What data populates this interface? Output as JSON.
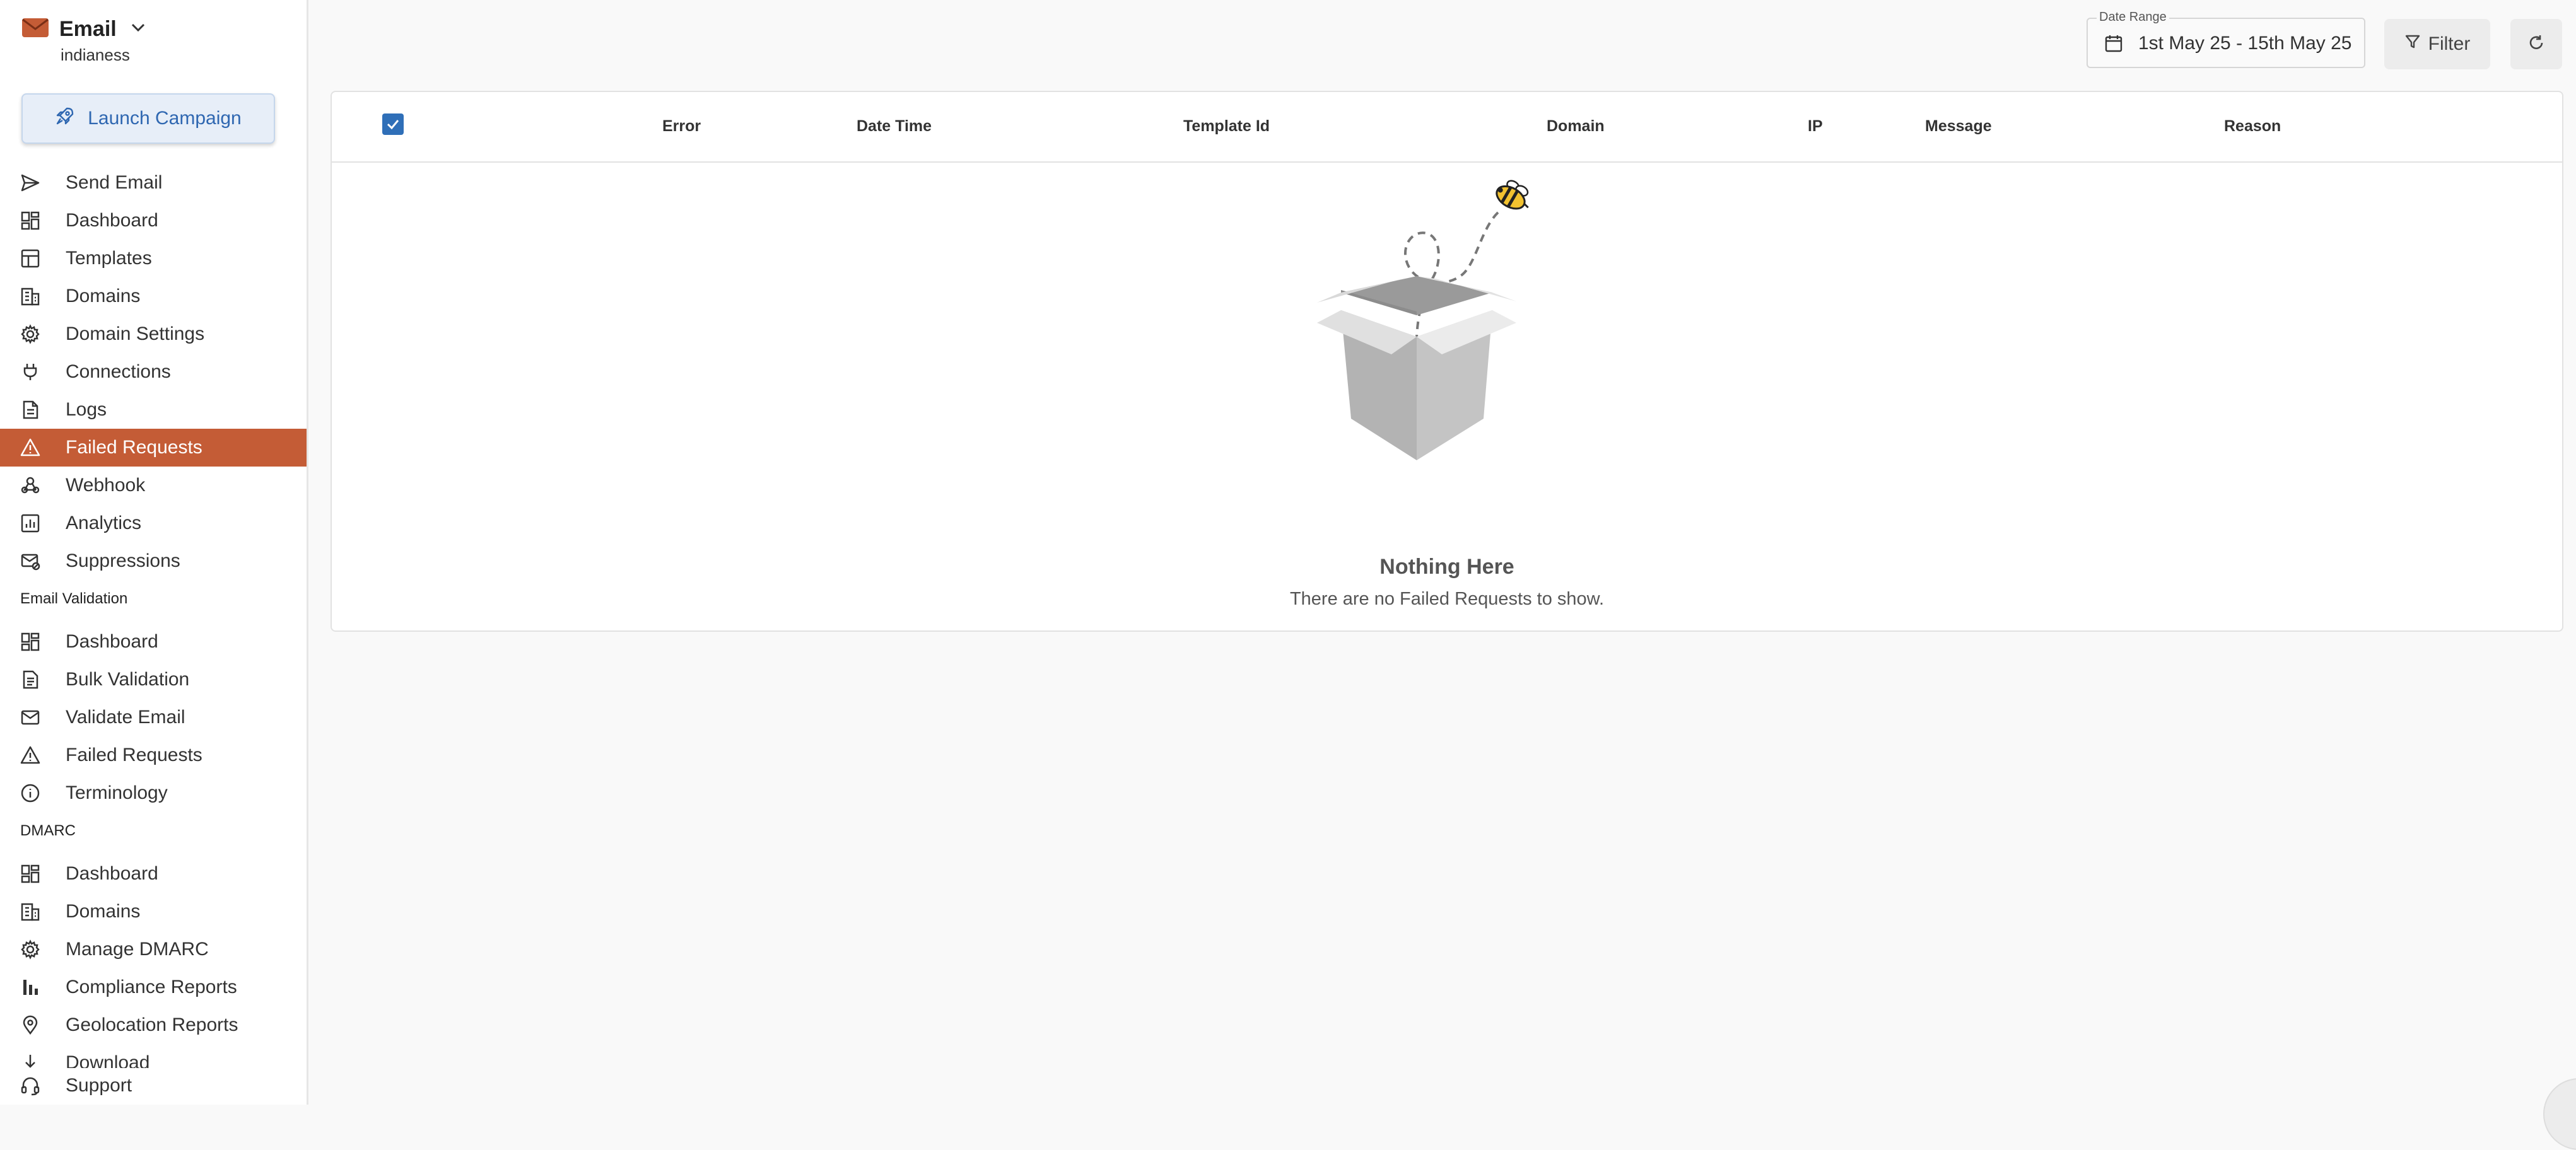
{
  "app": {
    "name": "Email",
    "account": "indianess",
    "launch_label": "Launch Campaign"
  },
  "sidebar": {
    "email_items": [
      {
        "label": "Send Email",
        "icon": "send-icon"
      },
      {
        "label": "Dashboard",
        "icon": "dashboard-icon"
      },
      {
        "label": "Templates",
        "icon": "templates-icon"
      },
      {
        "label": "Domains",
        "icon": "building-icon"
      },
      {
        "label": "Domain Settings",
        "icon": "gear-icon"
      },
      {
        "label": "Connections",
        "icon": "plug-icon"
      },
      {
        "label": "Logs",
        "icon": "document-icon"
      },
      {
        "label": "Failed Requests",
        "icon": "warning-icon",
        "active": true
      },
      {
        "label": "Webhook",
        "icon": "webhook-icon"
      },
      {
        "label": "Analytics",
        "icon": "analytics-icon"
      },
      {
        "label": "Suppressions",
        "icon": "mail-block-icon"
      }
    ],
    "validation_section": "Email Validation",
    "validation_items": [
      {
        "label": "Dashboard",
        "icon": "dashboard-icon"
      },
      {
        "label": "Bulk Validation",
        "icon": "document-list-icon"
      },
      {
        "label": "Validate Email",
        "icon": "mail-icon"
      },
      {
        "label": "Failed Requests",
        "icon": "warning-icon"
      },
      {
        "label": "Terminology",
        "icon": "info-icon"
      }
    ],
    "dmarc_section": "DMARC",
    "dmarc_items": [
      {
        "label": "Dashboard",
        "icon": "dashboard-icon"
      },
      {
        "label": "Domains",
        "icon": "building-icon"
      },
      {
        "label": "Manage DMARC",
        "icon": "gear-icon"
      },
      {
        "label": "Compliance Reports",
        "icon": "bar-chart-icon"
      },
      {
        "label": "Geolocation Reports",
        "icon": "location-pin-icon"
      },
      {
        "label": "Download",
        "icon": "download-icon"
      }
    ],
    "support_label": "Support"
  },
  "toolbar": {
    "date_range_label": "Date Range",
    "date_range_value": "1st May 25 - 15th May 25",
    "filter_label": "Filter"
  },
  "table": {
    "columns": [
      "Error",
      "Date Time",
      "Template Id",
      "Domain",
      "IP",
      "Message",
      "Reason"
    ],
    "select_all_checked": true,
    "empty_title": "Nothing Here",
    "empty_message": "There are no Failed Requests to show."
  },
  "colors": {
    "accent": "#c45c36",
    "primary": "#2f6fb8",
    "launch_bg": "#e7eef8"
  }
}
